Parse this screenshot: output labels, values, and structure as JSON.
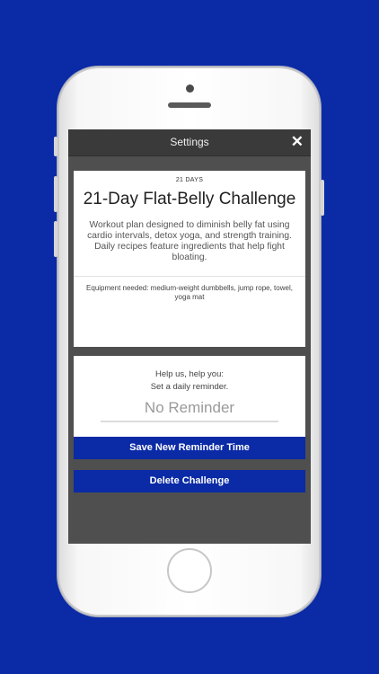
{
  "header": {
    "title": "Settings",
    "close_icon": "close-icon"
  },
  "challenge": {
    "duration_label": "21 DAYS",
    "title": "21-Day Flat-Belly Challenge",
    "description": "Workout plan designed to diminish belly fat using cardio intervals, detox yoga, and strength training. Daily recipes feature ingredients that help fight bloating.",
    "equipment": "Equipment needed: medium-weight dumbbells, jump rope, towel, yoga mat"
  },
  "reminder": {
    "help_line1": "Help us, help you:",
    "help_line2": "Set a daily reminder.",
    "value": "No Reminder"
  },
  "actions": {
    "save_label": "Save New Reminder Time",
    "delete_label": "Delete Challenge"
  },
  "colors": {
    "background": "#0a2aa6",
    "button": "#0a2aa6"
  }
}
